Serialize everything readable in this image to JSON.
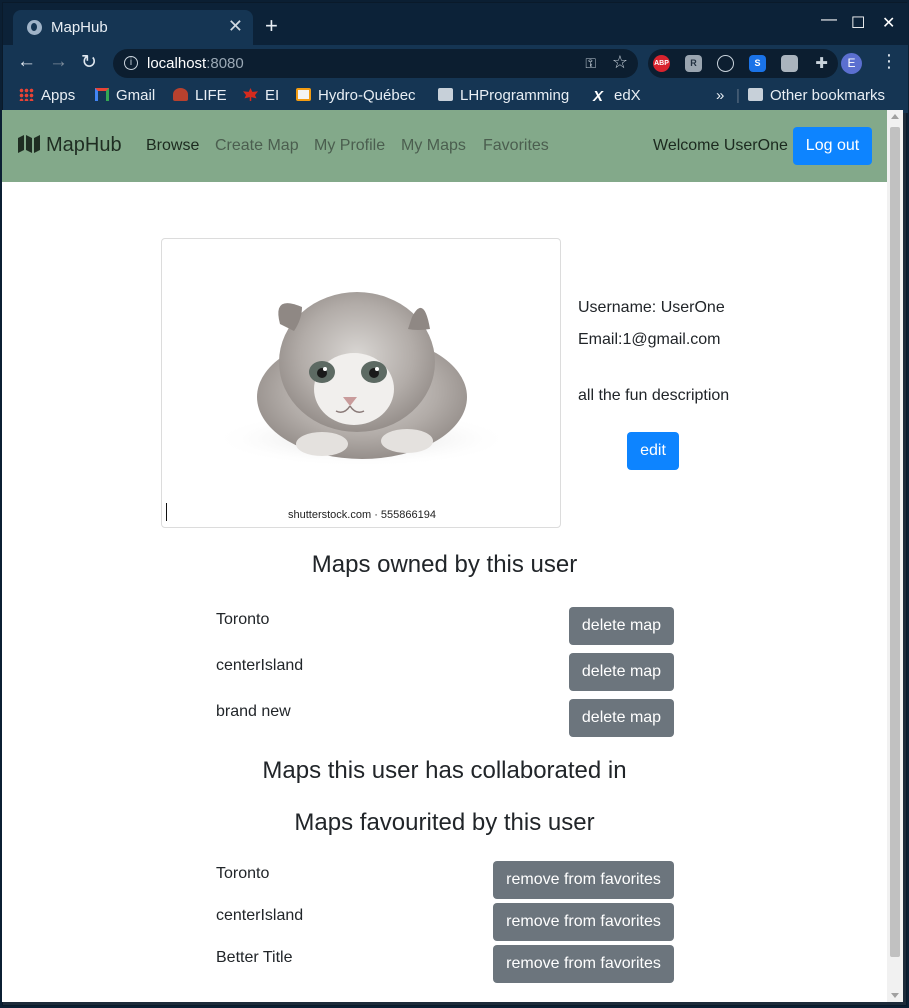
{
  "browser": {
    "tab_title": "MapHub",
    "url_host": "localhost",
    "url_port": ":8080",
    "bookmarks": [
      "Apps",
      "Gmail",
      "LIFE",
      "EI",
      "Hydro-Québec",
      "LHProgramming",
      "edX"
    ],
    "overflow_label": "»",
    "other_bookmarks": "Other bookmarks",
    "profile_initial": "E",
    "extensions": [
      "ABP",
      "R",
      "globe",
      "S",
      "bulb",
      "puzzle"
    ]
  },
  "app": {
    "brand": "MapHub",
    "nav": [
      "Browse",
      "Create Map",
      "My Profile",
      "My Maps",
      "Favorites"
    ],
    "welcome": "Welcome UserOne",
    "logout": "Log out"
  },
  "profile": {
    "image_caption": "shutterstock.com · 555866194",
    "username": "Username: UserOne",
    "email": "Email:1@gmail.com",
    "description": "all the fun description",
    "edit_label": "edit"
  },
  "owned": {
    "title": "Maps owned by this user",
    "button_label": "delete map",
    "items": [
      "Toronto",
      "centerIsland",
      "brand new"
    ]
  },
  "collaborated": {
    "title": "Maps this user has collaborated in"
  },
  "favourited": {
    "title": "Maps favourited by this user",
    "button_label": "remove from favorites",
    "items": [
      "Toronto",
      "centerIsland",
      "Better Title"
    ]
  },
  "colors": {
    "navbar": "#83a98a",
    "primary": "#0d84ff",
    "secondary": "#6c757d",
    "browser_frame": "#153553"
  }
}
